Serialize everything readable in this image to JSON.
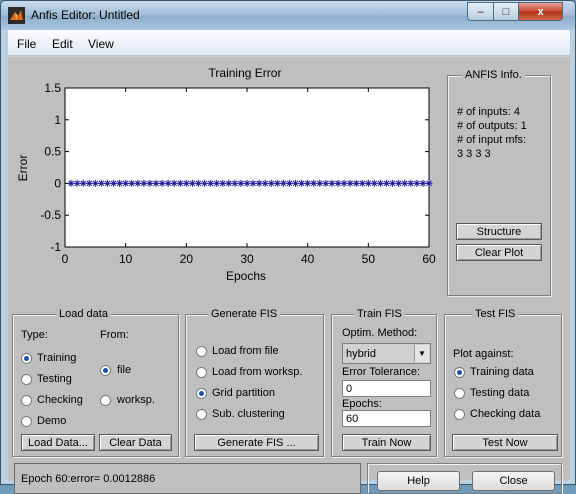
{
  "window": {
    "title": "Anfis Editor: Untitled",
    "minimize_glyph": "–",
    "maximize_glyph": "□",
    "close_glyph": "x"
  },
  "menu": [
    "File",
    "Edit",
    "View"
  ],
  "chart_data": {
    "type": "scatter",
    "title": "Training Error",
    "xlabel": "Epochs",
    "ylabel": "Error",
    "xlim": [
      0,
      60
    ],
    "ylim": [
      -1,
      1.5
    ],
    "xticks": [
      "0",
      "10",
      "20",
      "30",
      "40",
      "50",
      "60"
    ],
    "yticks": [
      "-1",
      "-0.5",
      "0",
      "0.5",
      "1",
      "1.5"
    ],
    "marker": "*",
    "marker_color": "#1a1a9c",
    "series": [
      {
        "x": [
          1,
          2,
          3,
          4,
          5,
          6,
          7,
          8,
          9,
          10,
          11,
          12,
          13,
          14,
          15,
          16,
          17,
          18,
          19,
          20,
          21,
          22,
          23,
          24,
          25,
          26,
          27,
          28,
          29,
          30,
          31,
          32,
          33,
          34,
          35,
          36,
          37,
          38,
          39,
          40,
          41,
          42,
          43,
          44,
          45,
          46,
          47,
          48,
          49,
          50,
          51,
          52,
          53,
          54,
          55,
          56,
          57,
          58,
          59,
          60
        ],
        "y": [
          0.0013,
          0.0013,
          0.0013,
          0.0013,
          0.0013,
          0.0013,
          0.0013,
          0.0013,
          0.0013,
          0.0013,
          0.0013,
          0.0013,
          0.0013,
          0.0013,
          0.0013,
          0.0013,
          0.0013,
          0.0013,
          0.0013,
          0.0013,
          0.0013,
          0.0013,
          0.0013,
          0.0013,
          0.0013,
          0.0013,
          0.0013,
          0.0013,
          0.0013,
          0.0013,
          0.0013,
          0.0013,
          0.0013,
          0.0013,
          0.0013,
          0.0013,
          0.0013,
          0.0013,
          0.0013,
          0.0013,
          0.0013,
          0.0013,
          0.0013,
          0.0013,
          0.0013,
          0.0013,
          0.0013,
          0.0013,
          0.0013,
          0.0013,
          0.0013,
          0.0013,
          0.0013,
          0.0013,
          0.0013,
          0.0013,
          0.0013,
          0.0013,
          0.0013,
          0.0013
        ]
      }
    ]
  },
  "anfis_info": {
    "title": "ANFIS Info.",
    "inputs": "# of inputs: 4",
    "outputs": "# of outputs: 1",
    "mfs_label": "# of input mfs:",
    "mfs_values": "3  3  3  3",
    "structure_button": "Structure",
    "clear_plot_button": "Clear Plot"
  },
  "load_data": {
    "title": "Load data",
    "type_label": "Type:",
    "from_label": "From:",
    "types": [
      "Training",
      "Testing",
      "Checking",
      "Demo"
    ],
    "selected_type": "Training",
    "sources": [
      "file",
      "worksp."
    ],
    "selected_source": "file",
    "load_button": "Load Data...",
    "clear_button": "Clear Data"
  },
  "generate_fis": {
    "title": "Generate FIS",
    "options": [
      "Load from file",
      "Load from worksp.",
      "Grid partition",
      "Sub. clustering"
    ],
    "selected": "Grid partition",
    "button": "Generate FIS ..."
  },
  "train_fis": {
    "title": "Train FIS",
    "method_label": "Optim. Method:",
    "method_value": "hybrid",
    "tolerance_label": "Error Tolerance:",
    "tolerance_value": "0",
    "epochs_label": "Epochs:",
    "epochs_value": "60",
    "button": "Train Now"
  },
  "test_fis": {
    "title": "Test FIS",
    "plot_against_label": "Plot against:",
    "options": [
      "Training data",
      "Testing data",
      "Checking data"
    ],
    "selected": "Training data",
    "button": "Test Now"
  },
  "status": "Epoch 60:error= 0.0012886",
  "help_button": "Help",
  "close_button": "Close"
}
